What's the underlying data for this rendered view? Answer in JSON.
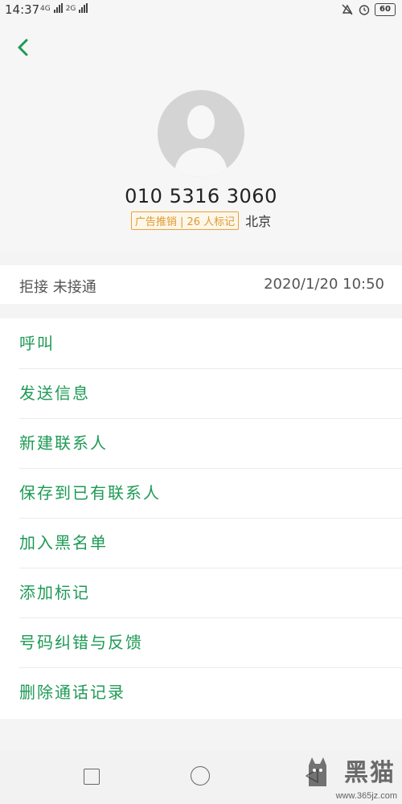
{
  "status_bar": {
    "time": "14:37",
    "network_1": "4G",
    "network_2": "2G",
    "battery": "60"
  },
  "header": {
    "phone_number": "010 5316 3060",
    "mark_tag": "广告推销 | 26 人标记",
    "location": "北京"
  },
  "call_record": {
    "status": "拒接 未接通",
    "time": "2020/1/20 10:50"
  },
  "actions": [
    {
      "label": "呼叫"
    },
    {
      "label": "发送信息"
    },
    {
      "label": "新建联系人"
    },
    {
      "label": "保存到已有联系人"
    },
    {
      "label": "加入黑名单"
    },
    {
      "label": "添加标记"
    },
    {
      "label": "号码纠错与反馈"
    },
    {
      "label": "删除通话记录"
    }
  ],
  "watermark": {
    "brand_cn": "黑猫",
    "url": "www.365jz.com"
  },
  "colors": {
    "accent": "#1d9a55",
    "tag": "#e09b2d"
  }
}
